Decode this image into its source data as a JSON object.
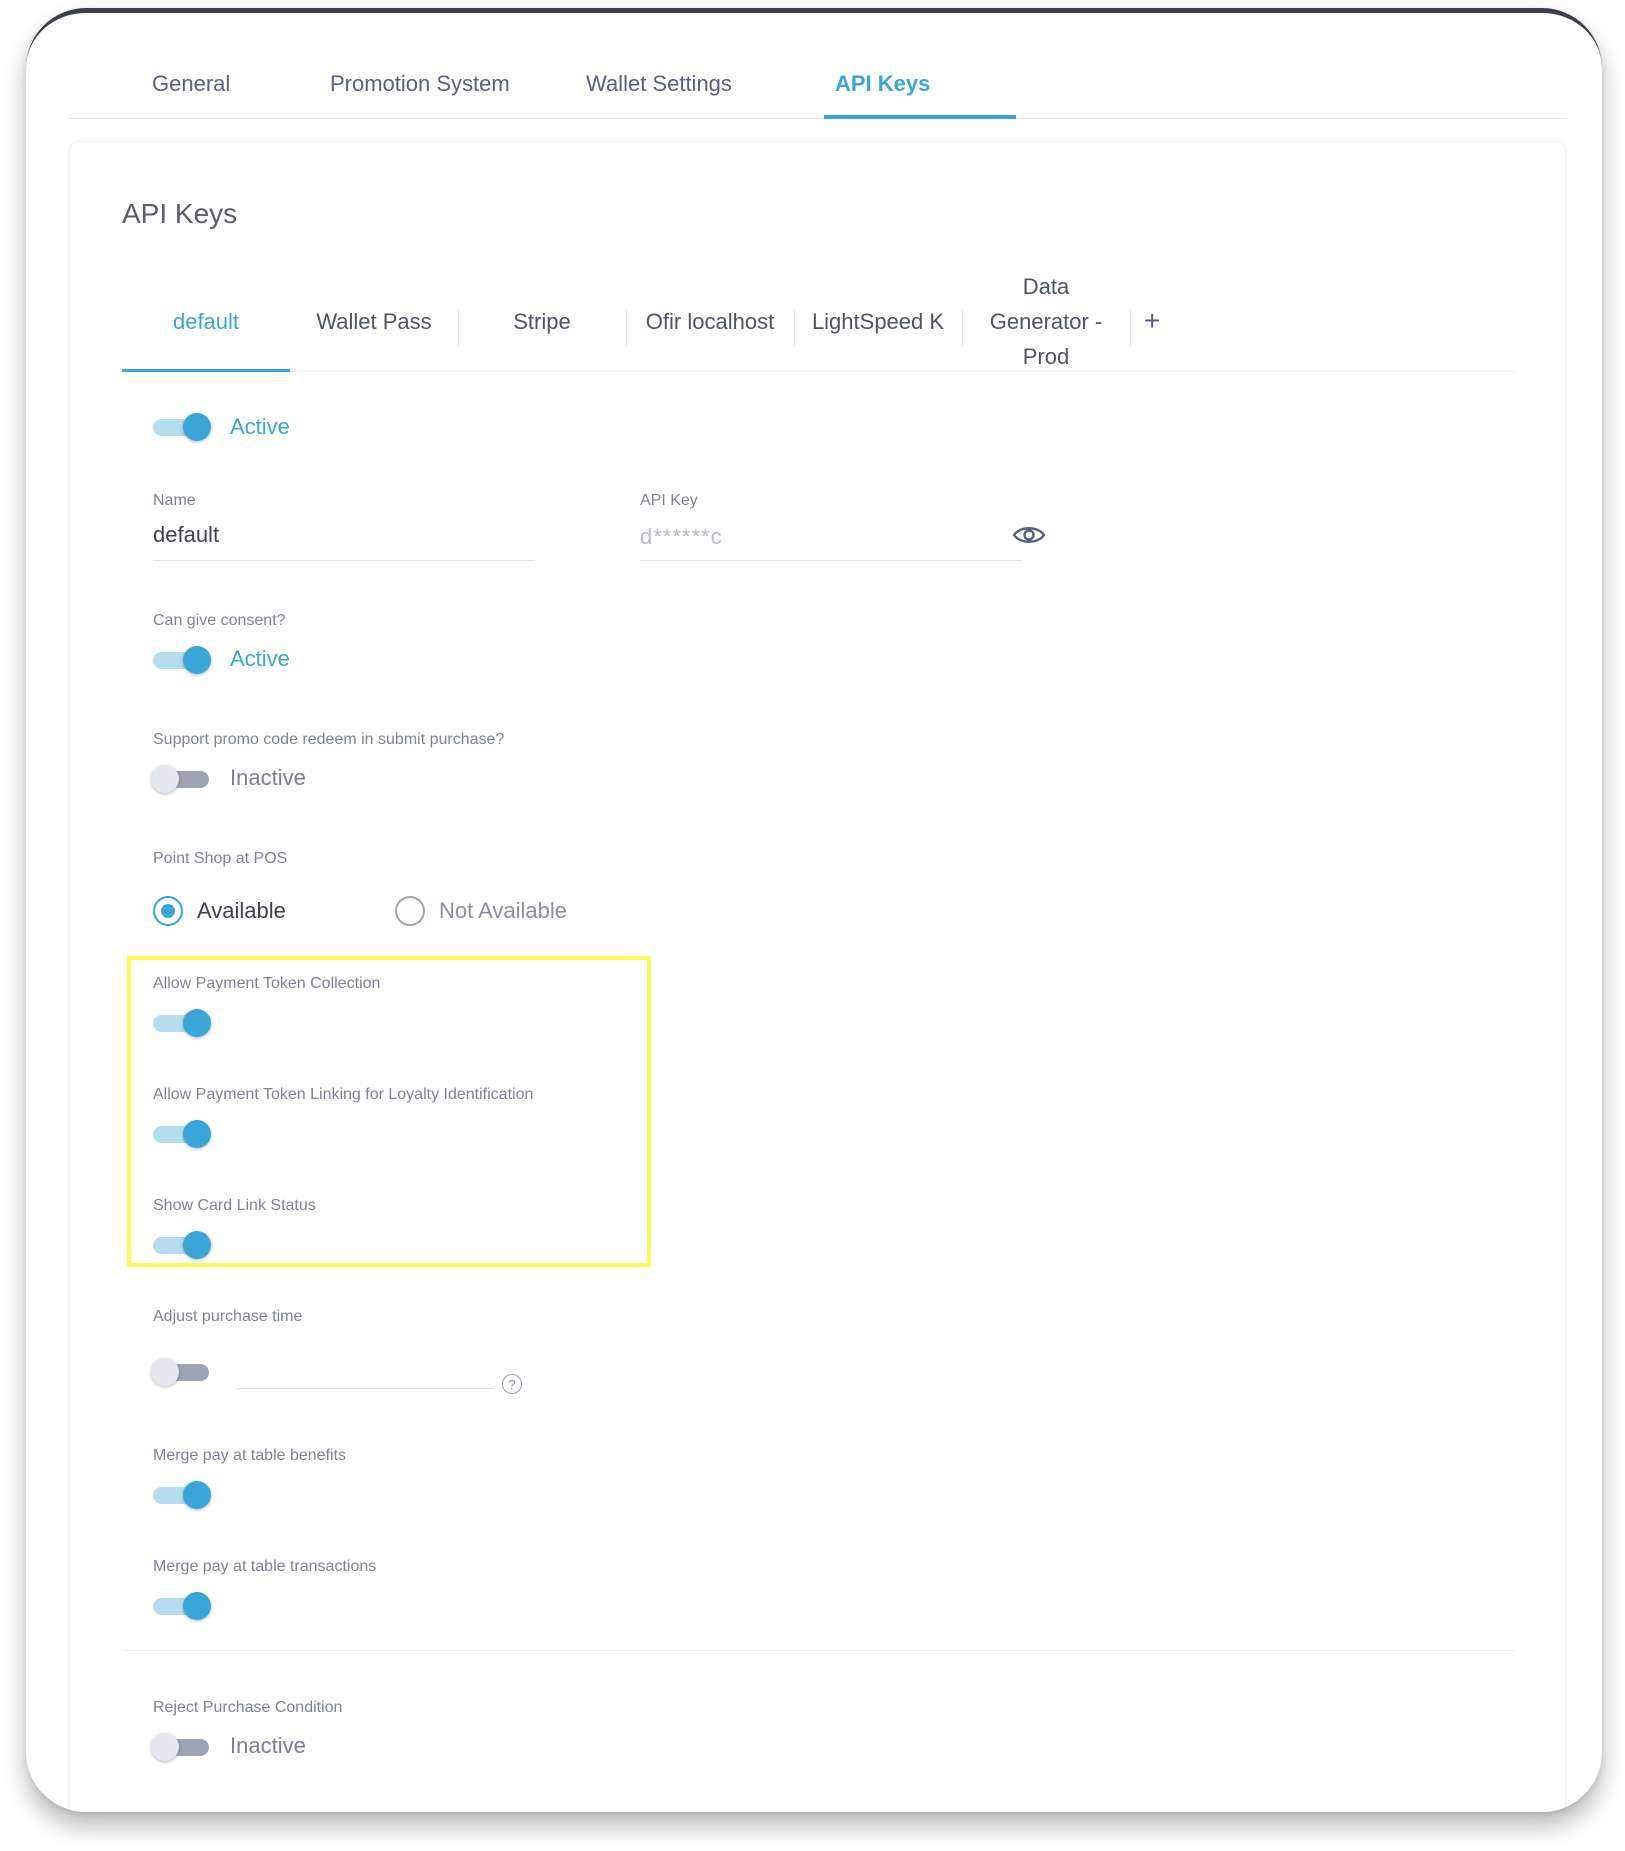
{
  "top_tabs": [
    {
      "label": "General"
    },
    {
      "label": "Promotion System"
    },
    {
      "label": "Wallet Settings"
    },
    {
      "label": "API Keys"
    }
  ],
  "card": {
    "title": "API Keys",
    "sub_tabs": [
      {
        "label": "default"
      },
      {
        "label": "Wallet Pass"
      },
      {
        "label": "Stripe"
      },
      {
        "label": "Ofir localhost"
      },
      {
        "label": "LightSpeed K"
      },
      {
        "label": "Data Generator - Prod"
      }
    ],
    "add_tab_label": "+"
  },
  "form": {
    "active_toggle": {
      "state_label": "Active",
      "on": true
    },
    "name": {
      "label": "Name",
      "value": "default"
    },
    "api_key": {
      "label": "API Key",
      "value": "d******c"
    },
    "consent": {
      "label": "Can give consent?",
      "state_label": "Active",
      "on": true
    },
    "promo_redeem": {
      "label": "Support promo code redeem in submit purchase?",
      "state_label": "Inactive",
      "on": false
    },
    "point_shop": {
      "label": "Point Shop at POS",
      "options": [
        {
          "label": "Available",
          "selected": true
        },
        {
          "label": "Not Available",
          "selected": false
        }
      ]
    },
    "payment_token_collection": {
      "label": "Allow Payment Token Collection",
      "on": true
    },
    "payment_token_linking": {
      "label": "Allow Payment Token Linking for Loyalty Identification",
      "on": true
    },
    "card_link_status": {
      "label": "Show Card Link Status",
      "on": true
    },
    "adjust_purchase_time": {
      "label": "Adjust purchase time",
      "on": false,
      "help_icon": "?"
    },
    "merge_benefits": {
      "label": "Merge pay at table benefits",
      "on": true
    },
    "merge_transactions": {
      "label": "Merge pay at table transactions",
      "on": true
    },
    "reject_condition": {
      "label": "Reject Purchase Condition",
      "state_label": "Inactive",
      "on": false
    }
  },
  "colors": {
    "accent": "#3aa6d8",
    "highlight": "#fbfa5a"
  },
  "icons": {
    "eye": "eye-icon",
    "help": "help-circle-icon",
    "plus": "plus-icon"
  }
}
